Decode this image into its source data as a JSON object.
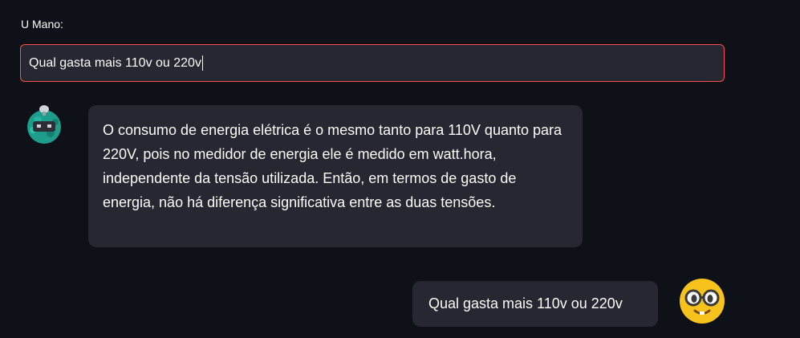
{
  "input": {
    "label": "U Mano:",
    "value": "Qual gasta mais 110v ou 220v"
  },
  "messages": [
    {
      "role": "assistant",
      "avatar_icon": "robot-avatar-icon",
      "text": "O consumo de energia elétrica é o mesmo tanto para 110V quanto para 220V, pois no medidor de energia ele é medido em watt.hora, independente da tensão utilizada. Então, em termos de gasto de energia, não há diferença significativa entre as duas tensões."
    },
    {
      "role": "user",
      "avatar_icon": "nerd-face-avatar-icon",
      "text": "Qual gasta mais 110v ou 220v"
    }
  ],
  "colors": {
    "background": "#0e1117",
    "bubble": "#262730",
    "input_border_focus": "#ff4b4b",
    "bot_avatar": "#1e9c8c",
    "user_avatar": "#f7c21c"
  }
}
